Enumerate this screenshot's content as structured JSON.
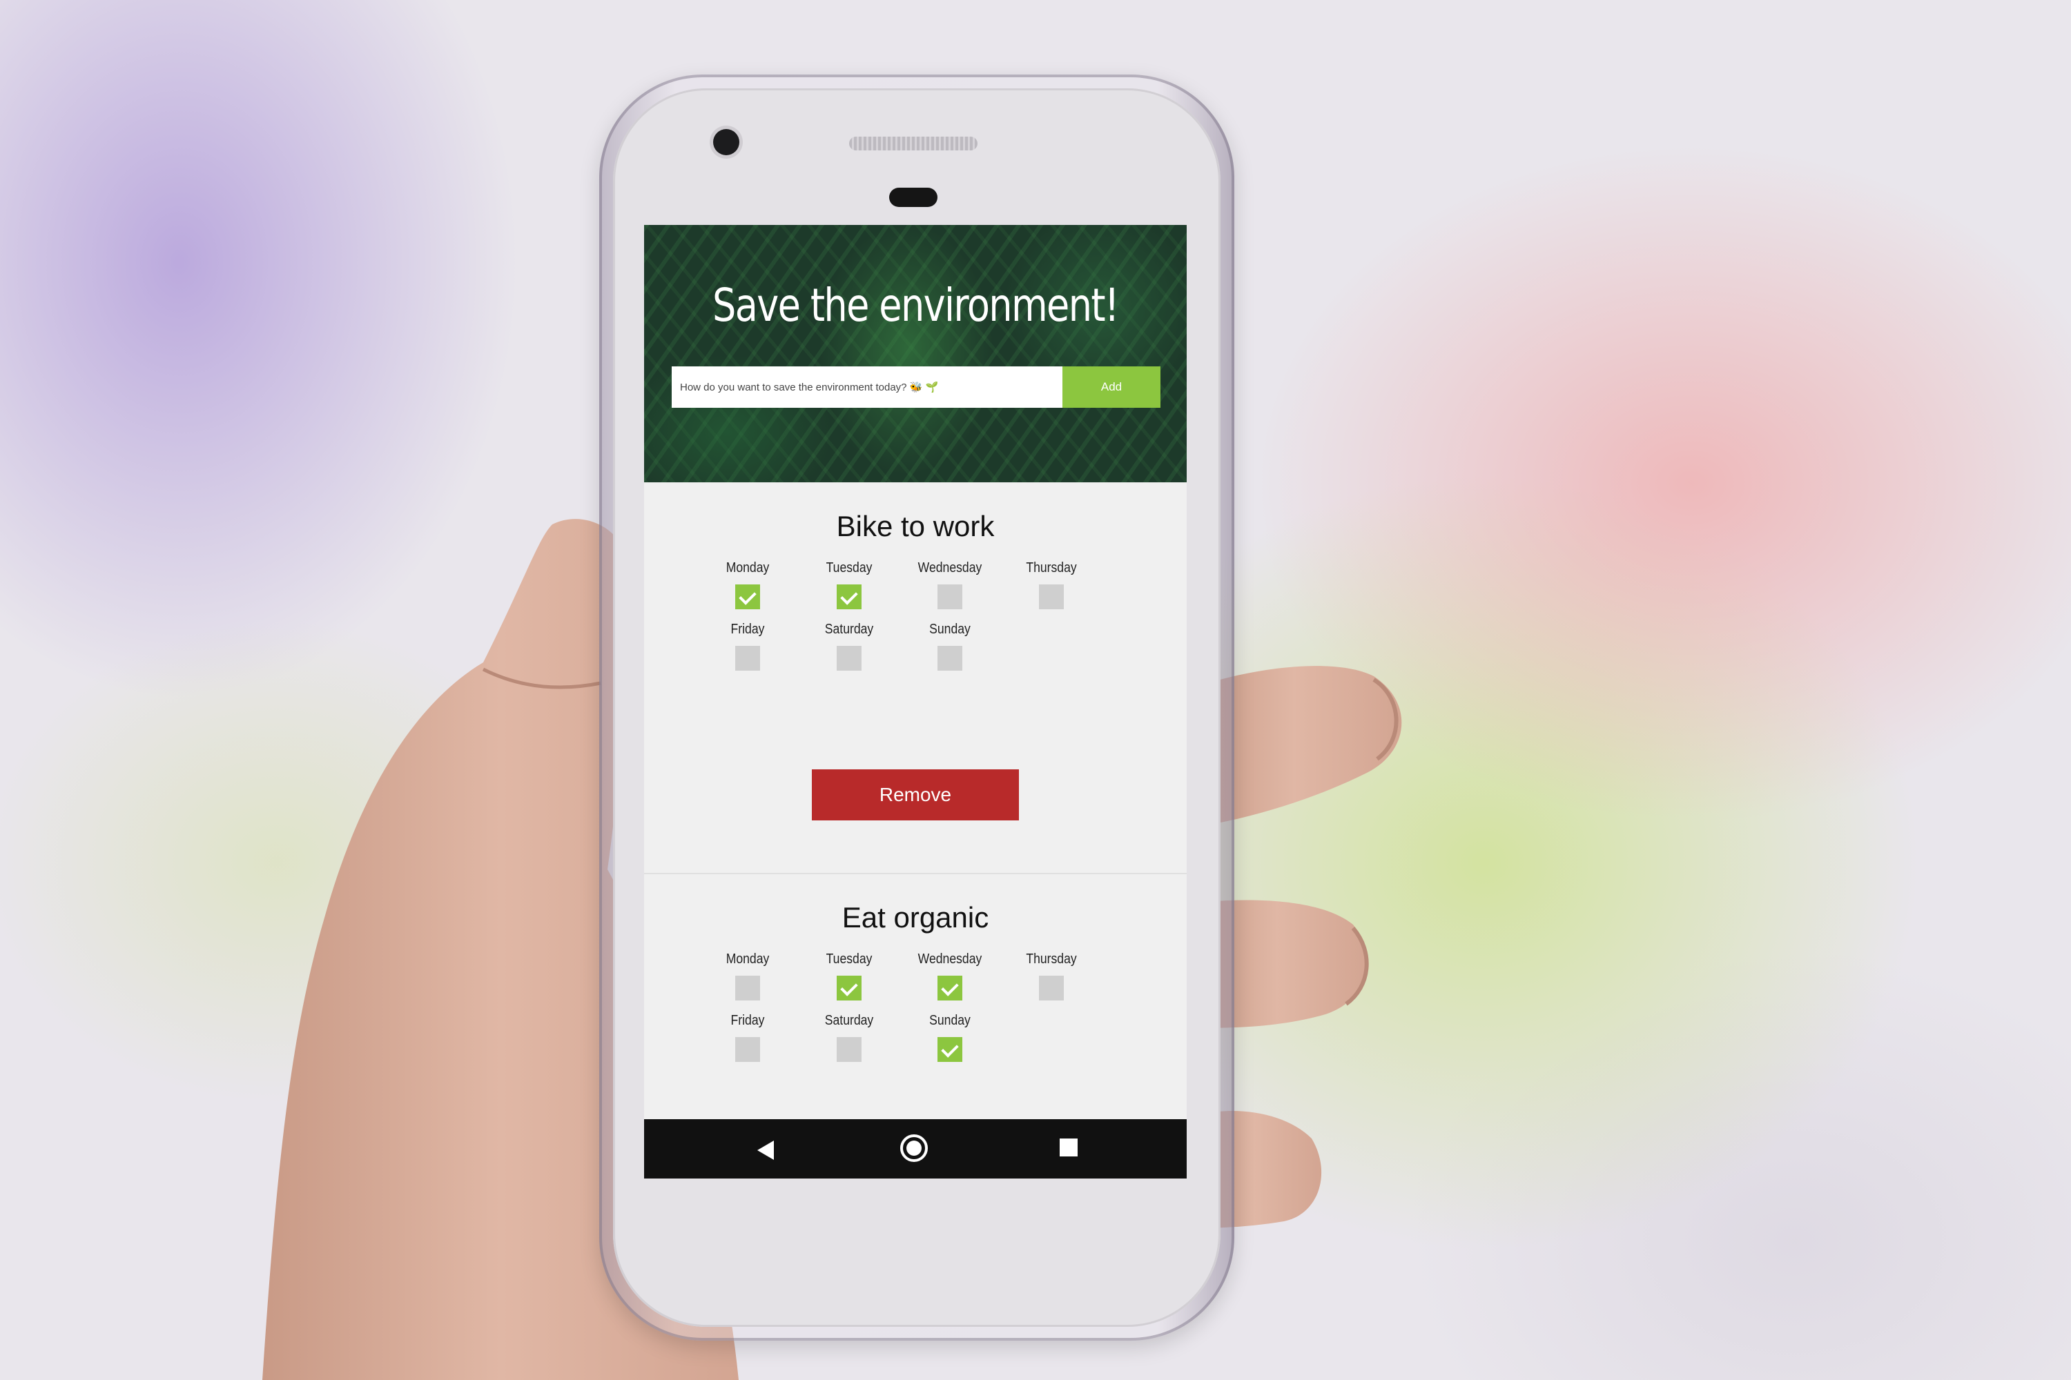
{
  "app": {
    "title": "Save the environment!",
    "input_placeholder": "How do you want to save the environment today? 🐝 🌱",
    "add_label": "Add"
  },
  "habits": [
    {
      "title": "Bike to work",
      "days": [
        {
          "label": "Monday",
          "checked": true
        },
        {
          "label": "Tuesday",
          "checked": true
        },
        {
          "label": "Wednesday",
          "checked": false
        },
        {
          "label": "Thursday",
          "checked": false
        },
        {
          "label": "Friday",
          "checked": false
        },
        {
          "label": "Saturday",
          "checked": false
        },
        {
          "label": "Sunday",
          "checked": false
        }
      ],
      "remove_label": "Remove"
    },
    {
      "title": "Eat organic",
      "days": [
        {
          "label": "Monday",
          "checked": false
        },
        {
          "label": "Tuesday",
          "checked": true
        },
        {
          "label": "Wednesday",
          "checked": true
        },
        {
          "label": "Thursday",
          "checked": false
        },
        {
          "label": "Friday",
          "checked": false
        },
        {
          "label": "Saturday",
          "checked": false
        },
        {
          "label": "Sunday",
          "checked": true
        }
      ]
    }
  ],
  "nav_bar": {
    "icons": [
      "back-icon",
      "home-icon",
      "recent-apps-icon"
    ]
  },
  "colors": {
    "accent_green": "#8cc63f",
    "remove_red": "#b82a2a",
    "header_dark_green": "#1d3a2a",
    "checkbox_unchecked": "#cfcfcf"
  }
}
